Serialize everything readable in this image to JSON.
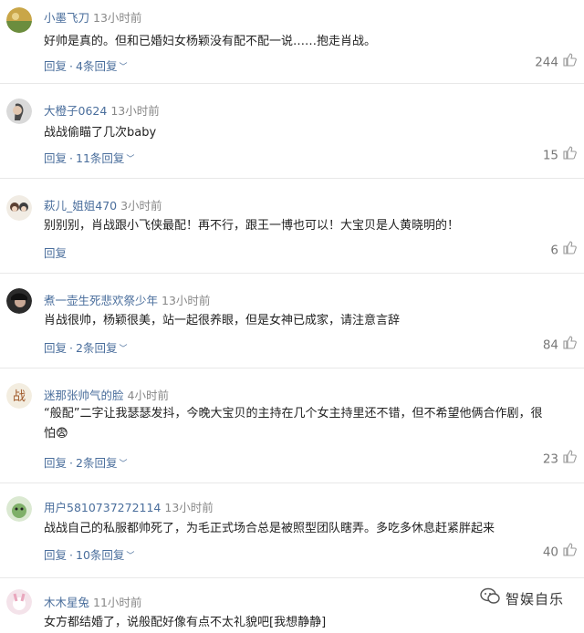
{
  "comments": [
    {
      "user": "小墨飞刀",
      "time": "13小时前",
      "text": [
        "好帅是真的。但和已婚妇女杨颖没有配不配一说……抱走肖战。"
      ],
      "reply_label": "回复",
      "replies": "4条回复",
      "likes": "244"
    },
    {
      "user": "大橙子0624",
      "time": "13小时前",
      "text": [
        "战战偷瞄了几次baby"
      ],
      "reply_label": "回复",
      "replies": "11条回复",
      "likes": "15"
    },
    {
      "user": "萩儿_姐姐470",
      "time": "3小时前",
      "text": [
        "别别别，肖战跟小飞侠最配！再不行，跟王一博也可以！大宝贝是人黄晓明的！"
      ],
      "reply_label": "回复",
      "replies": "",
      "likes": "6"
    },
    {
      "user": "煮一壶生死悲欢祭少年",
      "time": "13小时前",
      "text": [
        "肖战很帅，杨颖很美，站一起很养眼，但是女神已成家，请注意言辞"
      ],
      "reply_label": "回复",
      "replies": "2条回复",
      "likes": "84"
    },
    {
      "user": "迷那张帅气的脸",
      "time": "4小时前",
      "text": [
        "“般配”二字让我瑟瑟发抖，今晚大宝贝的主持在几个女主持里还不错，但不希望他俩合作剧，很",
        "怕😨"
      ],
      "reply_label": "回复",
      "replies": "2条回复",
      "likes": "23"
    },
    {
      "user": "用户5810737272114",
      "time": "13小时前",
      "text": [
        "战战自己的私服都帅死了，为毛正式场合总是被照型团队瞎弄。多吃多休息赶紧胖起来"
      ],
      "reply_label": "回复",
      "replies": "10条回复",
      "likes": "40"
    },
    {
      "user": "木木星兔",
      "time": "11小时前",
      "text": [
        "女方都结婚了，说般配好像有点不太礼貌吧[我想静静]"
      ],
      "reply_label": "",
      "replies": "",
      "likes": ""
    }
  ],
  "watermark": "智娱自乐",
  "colors": {
    "link": "#4a6e9c",
    "text": "#222222",
    "muted": "#888888",
    "divider": "#e8e8e8"
  }
}
